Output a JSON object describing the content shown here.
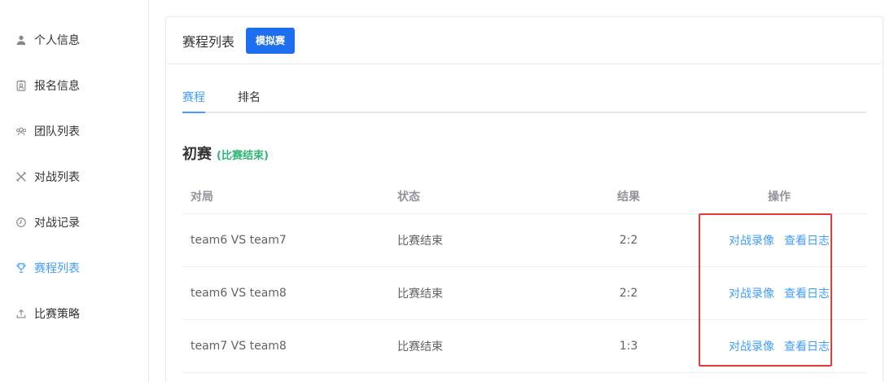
{
  "sidebar": {
    "items": [
      {
        "label": "个人信息",
        "icon": "user-icon"
      },
      {
        "label": "报名信息",
        "icon": "badge-icon"
      },
      {
        "label": "团队列表",
        "icon": "team-icon"
      },
      {
        "label": "对战列表",
        "icon": "swords-icon"
      },
      {
        "label": "对战记录",
        "icon": "clock-icon"
      },
      {
        "label": "赛程列表",
        "icon": "trophy-icon",
        "active": true
      },
      {
        "label": "比赛策略",
        "icon": "upload-icon"
      }
    ]
  },
  "card": {
    "title": "赛程列表",
    "sim_button": "模拟赛"
  },
  "tabs": [
    {
      "label": "赛程",
      "active": true
    },
    {
      "label": "排名",
      "active": false
    }
  ],
  "round": {
    "name": "初赛",
    "status": "(比赛结束)"
  },
  "table": {
    "headers": [
      "对局",
      "状态",
      "结果",
      "操作"
    ],
    "rows": [
      {
        "match": "team6 VS team7",
        "status": "比赛结束",
        "result": "2:2",
        "action1": "对战录像",
        "action2": "查看日志"
      },
      {
        "match": "team6 VS team8",
        "status": "比赛结束",
        "result": "2:2",
        "action1": "对战录像",
        "action2": "查看日志"
      },
      {
        "match": "team7 VS team8",
        "status": "比赛结束",
        "result": "1:3",
        "action1": "对战录像",
        "action2": "查看日志"
      }
    ]
  },
  "colors": {
    "accent": "#409eff",
    "button": "#1e6fef",
    "status_green": "#2bb673",
    "highlight_red": "#e53935"
  }
}
